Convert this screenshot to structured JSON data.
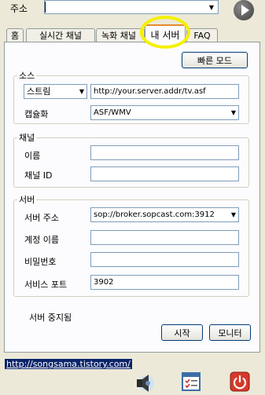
{
  "address": {
    "label": "주소",
    "value": ""
  },
  "tabs": [
    {
      "label": "홈"
    },
    {
      "label": "실시간 채널"
    },
    {
      "label": "녹화 채널"
    },
    {
      "label": "내 서버"
    },
    {
      "label": "FAQ"
    }
  ],
  "active_tab": "내 서버",
  "fast_mode_button": "빠른 모드",
  "source": {
    "legend": "소스",
    "type": "스트림",
    "url": "http://your.server.addr/tv.asf",
    "encapsulation_label": "캡슐화",
    "encapsulation": "ASF/WMV"
  },
  "channel": {
    "legend": "채널",
    "name_label": "이름",
    "name_value": "",
    "id_label": "채널 ID",
    "id_value": ""
  },
  "server": {
    "legend": "서버",
    "address_label": "서버 주소",
    "address_value": "sop://broker.sopcast.com:3912",
    "account_label": "계정 이름",
    "account_value": "",
    "password_label": "비밀번호",
    "password_value": "",
    "port_label": "서비스 포트",
    "port_value": "3902"
  },
  "status": "서버 중지됨",
  "start_button": "시작",
  "monitor_button": "모니터",
  "footer_link": "http://songsama.tistory.com/",
  "colors": {
    "highlight": "#f5f000",
    "link_bg": "#0a246a"
  }
}
